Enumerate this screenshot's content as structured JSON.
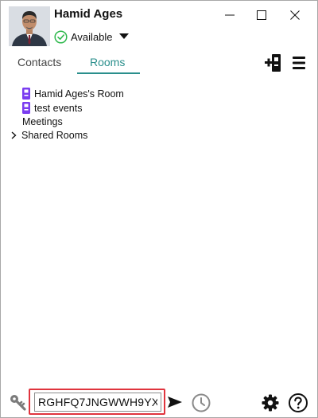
{
  "user": {
    "name": "Hamid Ages",
    "status": "Available"
  },
  "tabs": [
    {
      "label": "Contacts",
      "active": false
    },
    {
      "label": "Rooms",
      "active": true
    }
  ],
  "tree": {
    "items": [
      {
        "label": "Hamid Ages's Room",
        "icon": "room-icon"
      },
      {
        "label": "test events",
        "icon": "room-icon"
      },
      {
        "label": "Meetings"
      },
      {
        "label": "Shared Rooms",
        "icon": "chevron-right-icon"
      }
    ]
  },
  "footer": {
    "room_code": "RGHFQ7JNGWWH9YX"
  },
  "colors": {
    "accent": "#2a8f8c",
    "room_icon": "#7a3df0",
    "highlight": "#e0343e",
    "status_green": "#2db84b"
  }
}
